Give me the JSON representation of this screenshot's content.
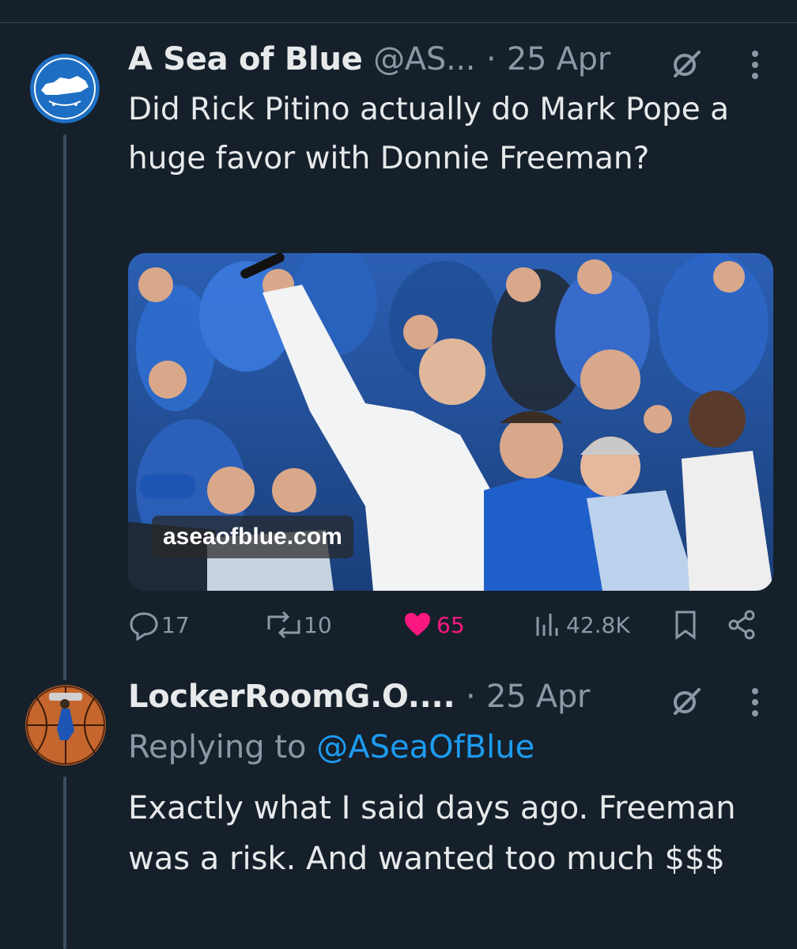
{
  "tweet1": {
    "display_name": "A Sea of Blue",
    "handle": "@AS...",
    "separator": "·",
    "date": "25 Apr",
    "avatar_icon": "kentucky-logo-avatar",
    "text": "Did Rick Pitino actually do Mark Pope a huge favor with Donnie Freeman?",
    "media_watermark": "aseaofblue.com",
    "actions": {
      "replies": "17",
      "reposts": "10",
      "likes": "65",
      "views": "42.8K"
    },
    "like_color": "#f91880"
  },
  "tweet2": {
    "display_name": "LockerRoomG.O....",
    "separator": "·",
    "date": "25 Apr",
    "avatar_icon": "basketball-avatar",
    "replying_prefix": "Replying to",
    "replying_handle": "@ASeaOfBlue",
    "text": "Exactly what I said days ago. Freeman was a risk.  And wanted too much $$$"
  },
  "colors": {
    "background": "#15202b",
    "text": "#e7e9ea",
    "muted": "#8b98a5",
    "link": "#1d9bf0"
  }
}
